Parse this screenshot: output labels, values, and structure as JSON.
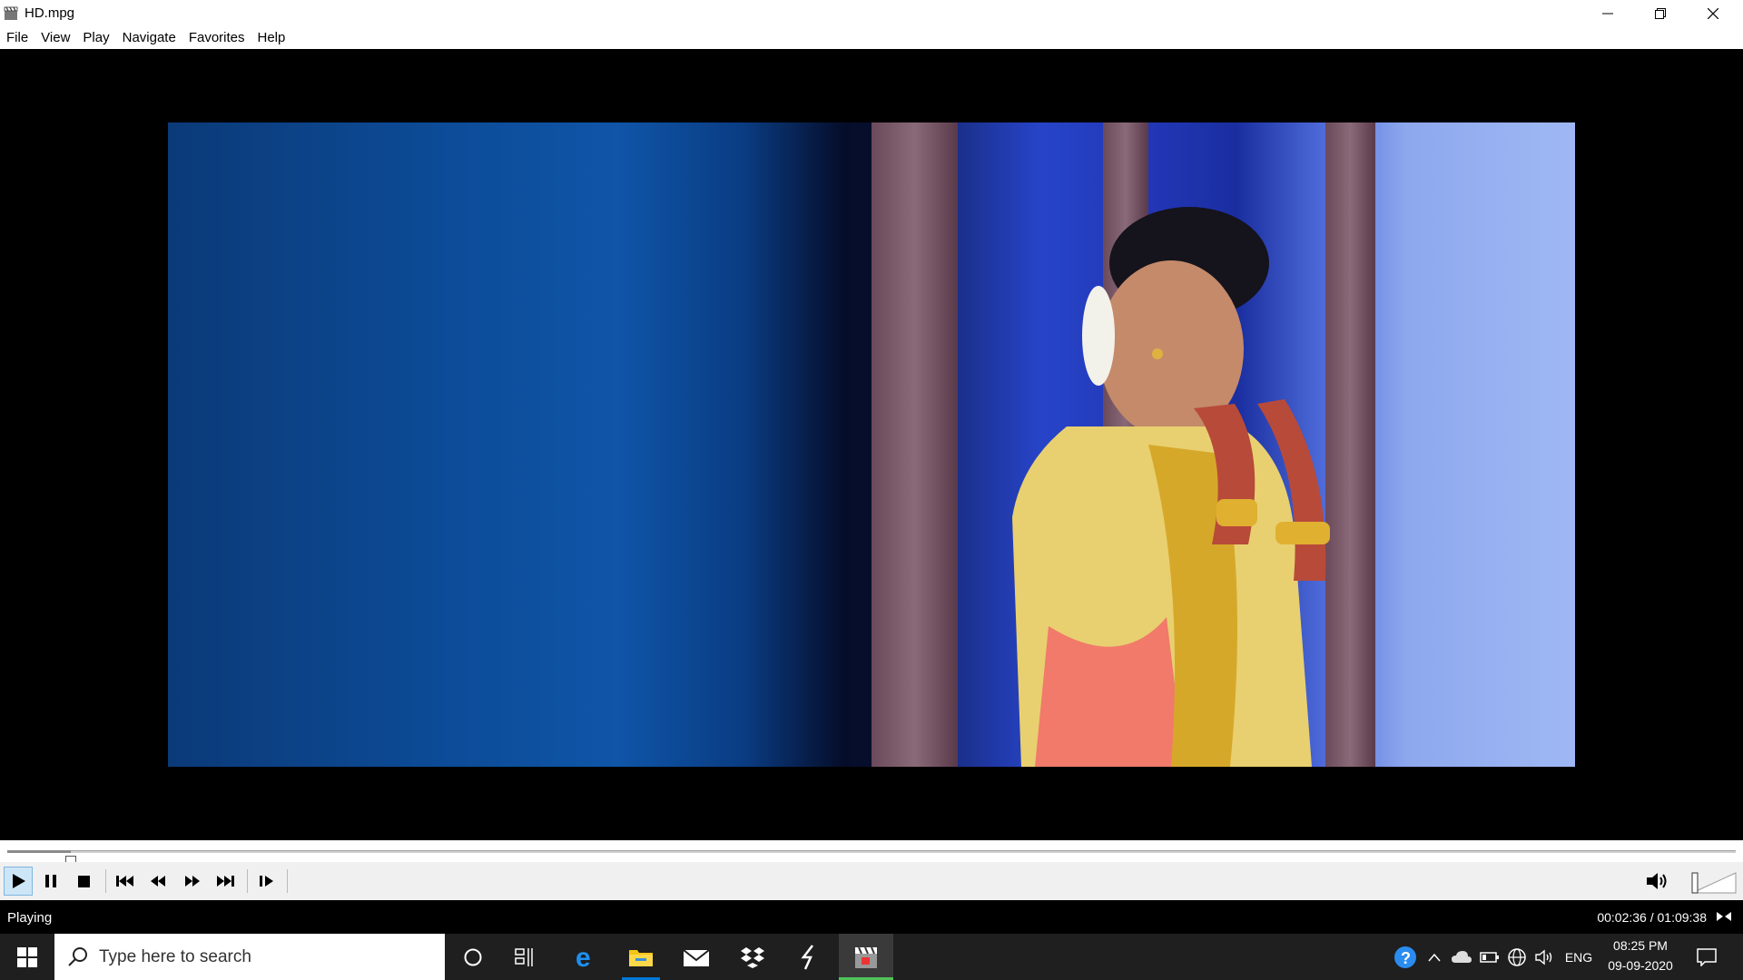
{
  "window": {
    "title": "HD.mpg",
    "controls": {
      "minimize": "minimize-icon",
      "restore": "restore-icon",
      "close": "close-icon"
    }
  },
  "menu": [
    "File",
    "View",
    "Play",
    "Navigate",
    "Favorites",
    "Help"
  ],
  "player": {
    "seek_progress_fraction": 0.037,
    "toolbar": [
      "play-icon",
      "pause-icon",
      "stop-icon",
      "previous-icon",
      "rewind-icon",
      "fast-forward-icon",
      "next-icon",
      "frame-step-icon"
    ],
    "volume_level_fraction": 0.0,
    "status": "Playing",
    "time": "00:02:36 / 01:09:38"
  },
  "taskbar": {
    "search_placeholder": "Type here to search",
    "apps": [
      "cortana-icon",
      "task-view-icon",
      "edge-icon",
      "file-explorer-icon",
      "mail-icon",
      "dropbox-icon",
      "app-icon",
      "media-player-classic-icon"
    ],
    "tray_language": "ENG",
    "clock_time": "08:25 PM",
    "clock_date": "09-09-2020"
  },
  "colors": {
    "accent_active_app": "#4fc35a",
    "explorer_underline": "#0078d7"
  }
}
